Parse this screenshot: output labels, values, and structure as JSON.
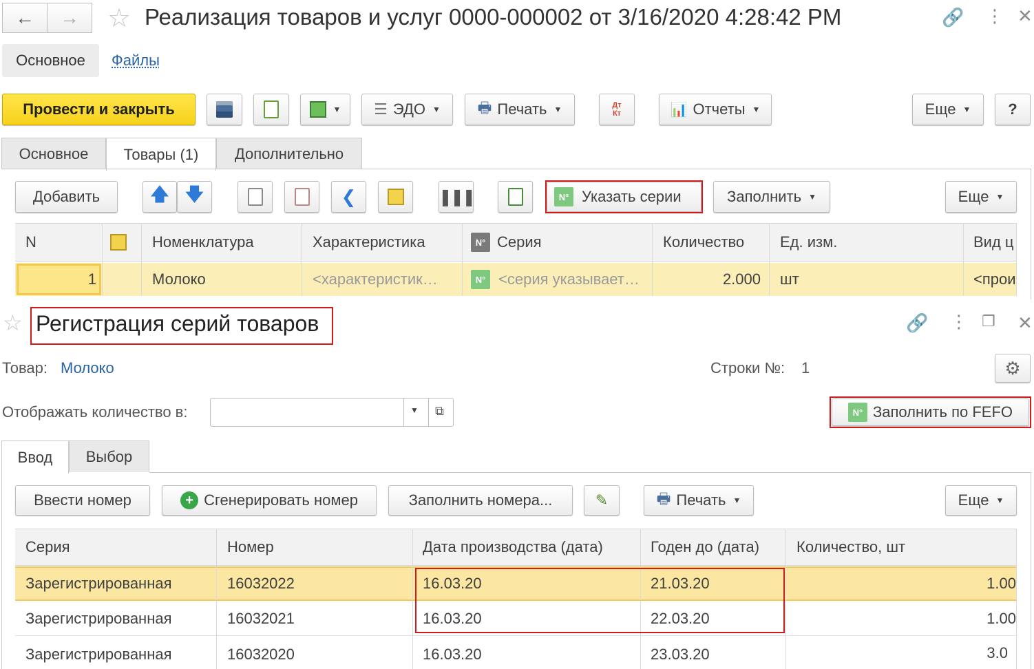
{
  "colors": {
    "accent_yellow": "#f7d21b",
    "selected_row": "#fbefb7",
    "highlight_red": "#d11a1a",
    "link_blue": "#2a63a5"
  },
  "main_window": {
    "title": "Реализация товаров и услуг 0000-000002 от 3/16/2020 4:28:42 PM",
    "nav": {
      "back_icon": "arrow-left-icon",
      "forward_icon": "arrow-right-icon",
      "star_icon": "star-icon"
    },
    "window_icons": [
      "link-icon",
      "more-icon",
      "close-icon"
    ],
    "section_tabs": [
      "Основное",
      "Файлы"
    ],
    "toolbar": {
      "post_close": "Провести и закрыть",
      "edo": "ЭДО",
      "print": "Печать",
      "reports": "Отчеты",
      "more": "Еще",
      "help": "?",
      "dt_kt": "Дт Кт"
    },
    "tabs": [
      "Основное",
      "Товары (1)",
      "Дополнительно"
    ],
    "goods_toolbar": {
      "add": "Добавить",
      "specify_series": "Указать серии",
      "fill": "Заполнить",
      "more": "Еще"
    },
    "table": {
      "columns": [
        "N",
        "",
        "Номенклатура",
        "Характеристика",
        "Серия",
        "Количество",
        "Ед. изм.",
        "Вид ц"
      ],
      "rows": [
        {
          "n": "1",
          "item": "Молоко",
          "characteristic": "<характеристик…",
          "series": "<серия указывает…",
          "qty": "2.000",
          "unit": "шт",
          "price_type": "<прои"
        }
      ]
    }
  },
  "series_window": {
    "title": "Регистрация серий товаров",
    "window_icons": [
      "link-icon",
      "more-icon",
      "restore-icon",
      "close-icon"
    ],
    "product_label": "Товар:",
    "product_value": "Молоко",
    "rows_label": "Строки №:",
    "rows_value": "1",
    "display_qty_label": "Отображать количество в:",
    "display_qty_value": "",
    "fill_fefo": "Заполнить по FEFO",
    "tabs": [
      "Ввод",
      "Выбор"
    ],
    "toolbar": {
      "enter_number": "Ввести номер",
      "generate_number": "Сгенерировать номер",
      "fill_numbers": "Заполнить номера...",
      "print": "Печать",
      "more": "Еще"
    },
    "table": {
      "columns": [
        "Серия",
        "Номер",
        "Дата производства (дата)",
        "Годен до (дата)",
        "Количество, шт"
      ],
      "rows": [
        {
          "series": "Зарегистрированная",
          "number": "16032022",
          "prod_date": "16.03.20",
          "expiry": "21.03.20",
          "qty": "1.00"
        },
        {
          "series": "Зарегистрированная",
          "number": "16032021",
          "prod_date": "16.03.20",
          "expiry": "22.03.20",
          "qty": "1.00"
        },
        {
          "series": "Зарегистрированная",
          "number": "16032020",
          "prod_date": "16.03.20",
          "expiry": "23.03.20",
          "qty": "3.0"
        }
      ]
    }
  }
}
